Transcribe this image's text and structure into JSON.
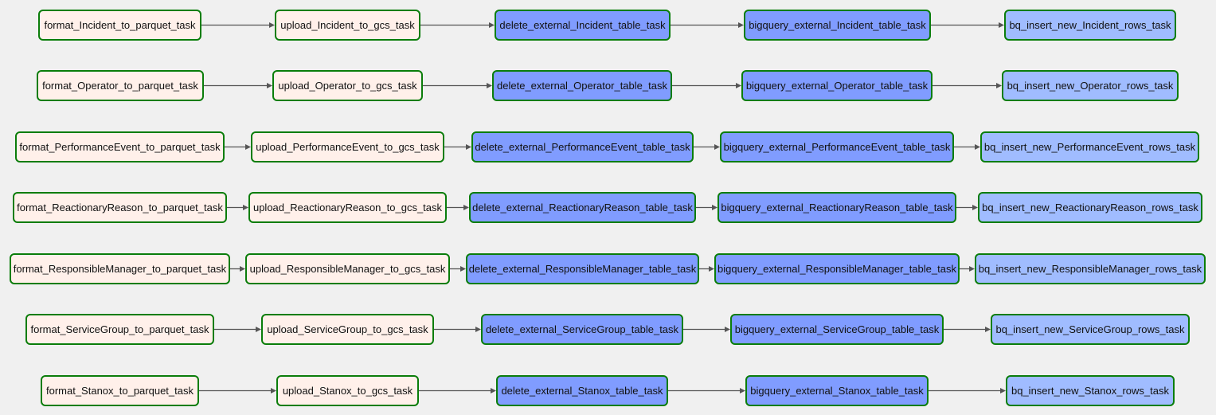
{
  "graph": {
    "status_border_color": "#0a7d0a",
    "operator_colors": {
      "local": "#fff0ea",
      "bq-ext": "#809cff",
      "bq-insert": "#a0bcff"
    },
    "rows": [
      {
        "entity": "Incident",
        "tasks": [
          {
            "id": "format_Incident_to_parquet_task",
            "type": "local"
          },
          {
            "id": "upload_Incident_to_gcs_task",
            "type": "local"
          },
          {
            "id": "delete_external_Incident_table_task",
            "type": "bq-ext"
          },
          {
            "id": "bigquery_external_Incident_table_task",
            "type": "bq-ext"
          },
          {
            "id": "bq_insert_new_Incident_rows_task",
            "type": "bq-insert"
          }
        ]
      },
      {
        "entity": "Operator",
        "tasks": [
          {
            "id": "format_Operator_to_parquet_task",
            "type": "local"
          },
          {
            "id": "upload_Operator_to_gcs_task",
            "type": "local"
          },
          {
            "id": "delete_external_Operator_table_task",
            "type": "bq-ext"
          },
          {
            "id": "bigquery_external_Operator_table_task",
            "type": "bq-ext"
          },
          {
            "id": "bq_insert_new_Operator_rows_task",
            "type": "bq-insert"
          }
        ]
      },
      {
        "entity": "PerformanceEvent",
        "tasks": [
          {
            "id": "format_PerformanceEvent_to_parquet_task",
            "type": "local"
          },
          {
            "id": "upload_PerformanceEvent_to_gcs_task",
            "type": "local"
          },
          {
            "id": "delete_external_PerformanceEvent_table_task",
            "type": "bq-ext"
          },
          {
            "id": "bigquery_external_PerformanceEvent_table_task",
            "type": "bq-ext"
          },
          {
            "id": "bq_insert_new_PerformanceEvent_rows_task",
            "type": "bq-insert"
          }
        ]
      },
      {
        "entity": "ReactionaryReason",
        "tasks": [
          {
            "id": "format_ReactionaryReason_to_parquet_task",
            "type": "local"
          },
          {
            "id": "upload_ReactionaryReason_to_gcs_task",
            "type": "local"
          },
          {
            "id": "delete_external_ReactionaryReason_table_task",
            "type": "bq-ext"
          },
          {
            "id": "bigquery_external_ReactionaryReason_table_task",
            "type": "bq-ext"
          },
          {
            "id": "bq_insert_new_ReactionaryReason_rows_task",
            "type": "bq-insert"
          }
        ]
      },
      {
        "entity": "ResponsibleManager",
        "tasks": [
          {
            "id": "format_ResponsibleManager_to_parquet_task",
            "type": "local"
          },
          {
            "id": "upload_ResponsibleManager_to_gcs_task",
            "type": "local"
          },
          {
            "id": "delete_external_ResponsibleManager_table_task",
            "type": "bq-ext"
          },
          {
            "id": "bigquery_external_ResponsibleManager_table_task",
            "type": "bq-ext"
          },
          {
            "id": "bq_insert_new_ResponsibleManager_rows_task",
            "type": "bq-insert"
          }
        ]
      },
      {
        "entity": "ServiceGroup",
        "tasks": [
          {
            "id": "format_ServiceGroup_to_parquet_task",
            "type": "local"
          },
          {
            "id": "upload_ServiceGroup_to_gcs_task",
            "type": "local"
          },
          {
            "id": "delete_external_ServiceGroup_table_task",
            "type": "bq-ext"
          },
          {
            "id": "bigquery_external_ServiceGroup_table_task",
            "type": "bq-ext"
          },
          {
            "id": "bq_insert_new_ServiceGroup_rows_task",
            "type": "bq-insert"
          }
        ]
      },
      {
        "entity": "Stanox",
        "tasks": [
          {
            "id": "format_Stanox_to_parquet_task",
            "type": "local"
          },
          {
            "id": "upload_Stanox_to_gcs_task",
            "type": "local"
          },
          {
            "id": "delete_external_Stanox_table_task",
            "type": "bq-ext"
          },
          {
            "id": "bigquery_external_Stanox_table_task",
            "type": "bq-ext"
          },
          {
            "id": "bq_insert_new_Stanox_rows_task",
            "type": "bq-insert"
          }
        ]
      }
    ]
  }
}
